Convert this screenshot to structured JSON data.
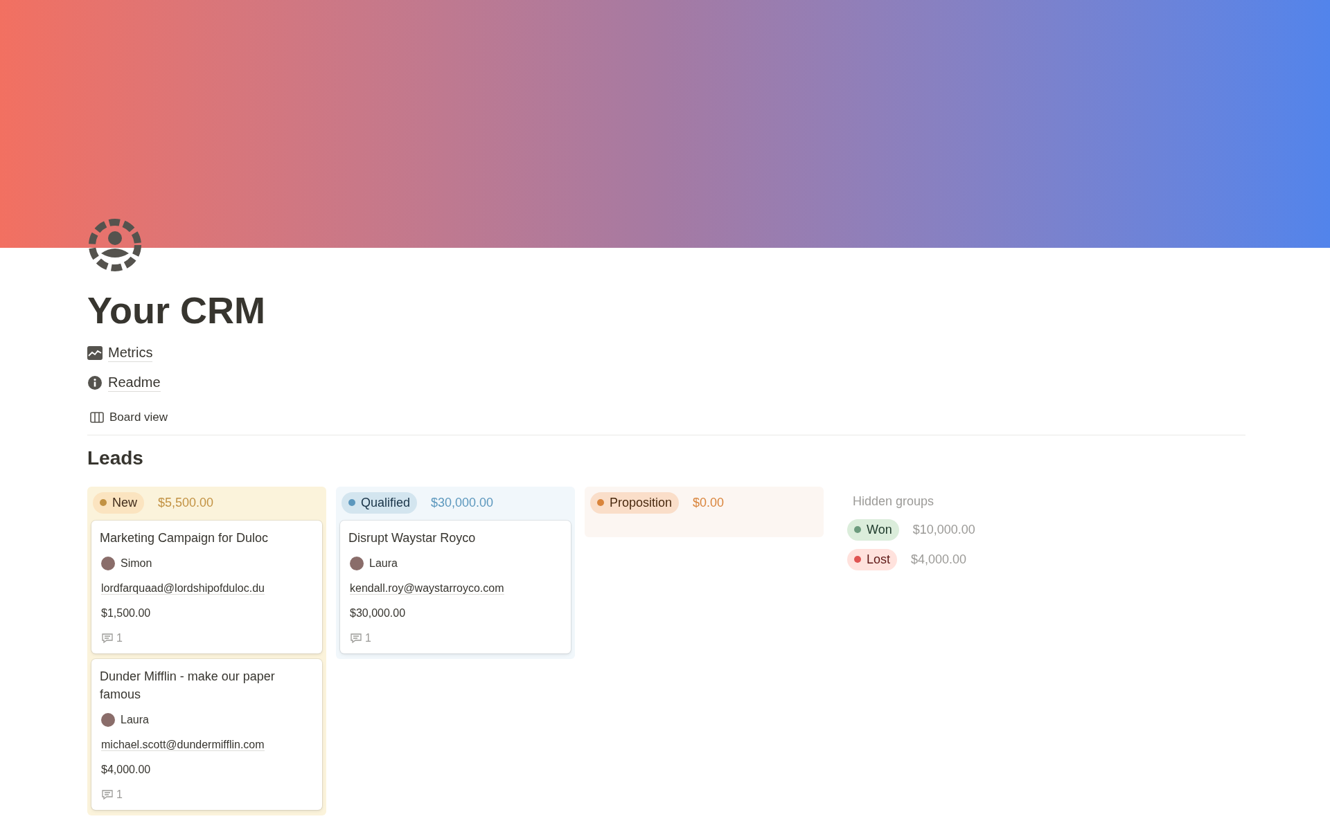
{
  "page": {
    "title": "Your CRM",
    "links": [
      {
        "kind": "chart",
        "label": "Metrics"
      },
      {
        "kind": "info",
        "label": "Readme"
      }
    ]
  },
  "view_tab": {
    "label": "Board view"
  },
  "database": {
    "title": "Leads",
    "groups": [
      {
        "label": "New",
        "total": "$5,500.00",
        "color": "#c29243",
        "cards": [
          {
            "title": "Marketing Campaign for Duloc",
            "owner": "Simon",
            "email": "lordfarquaad@lordshipofduloc.du",
            "amount": "$1,500.00",
            "comments": "1"
          },
          {
            "title": "Dunder Mifflin - make our paper famous",
            "owner": "Laura",
            "email": "michael.scott@dundermifflin.com",
            "amount": "$4,000.00",
            "comments": "1"
          }
        ]
      },
      {
        "label": "Qualified",
        "total": "$30,000.00",
        "color": "#5b97bd",
        "cards": [
          {
            "title": "Disrupt Waystar Royco",
            "owner": "Laura",
            "email": "kendall.roy@waystarroyco.com",
            "amount": "$30,000.00",
            "comments": "1"
          }
        ]
      },
      {
        "label": "Proposition",
        "total": "$0.00",
        "color": "#d9843b"
      }
    ],
    "hidden_groups": {
      "title": "Hidden groups",
      "groups": [
        {
          "label": "Won",
          "total": "$10,000.00",
          "color": "#6c9b7d"
        },
        {
          "label": "Lost",
          "total": "$4,000.00",
          "color": "#df5452"
        }
      ]
    }
  }
}
